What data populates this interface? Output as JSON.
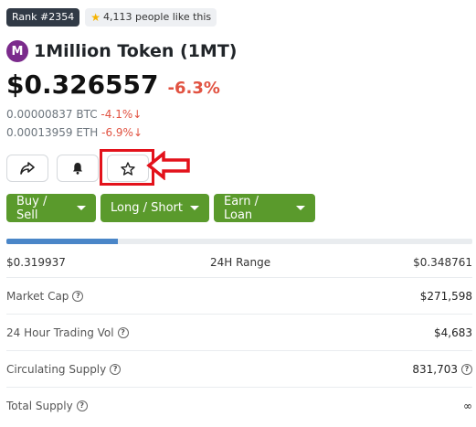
{
  "badges": {
    "rank": "Rank #2354",
    "likes": "4,113 people like this"
  },
  "coin": {
    "logo_letter": "M",
    "name": "1Million Token (1MT)",
    "price": "$0.326557",
    "price_change": "-6.3%"
  },
  "conversions": {
    "btc_value": "0.00000837 BTC",
    "btc_change": "-4.1%",
    "eth_value": "0.00013959 ETH",
    "eth_change": "-6.9%",
    "down_arrow": "↓"
  },
  "actions": {
    "share_icon": "share-icon",
    "bell_icon": "bell-icon",
    "star_icon": "star-icon"
  },
  "trade_buttons": {
    "buy_sell": "Buy / Sell",
    "long_short": "Long / Short",
    "earn_loan": "Earn / Loan"
  },
  "range": {
    "low": "$0.319937",
    "label": "24H Range",
    "high": "$0.348761",
    "fill_fraction": 0.24
  },
  "stats": [
    {
      "label": "Market Cap",
      "value": "$271,598"
    },
    {
      "label": "24 Hour Trading Vol",
      "value": "$4,683"
    },
    {
      "label": "Circulating Supply",
      "value": "831,703"
    },
    {
      "label": "Total Supply",
      "value": "∞"
    }
  ],
  "colors": {
    "accent_green": "#5a9a2c",
    "negative_red": "#e15241",
    "highlight_red": "#e3121b",
    "range_blue": "#4a86c8"
  }
}
